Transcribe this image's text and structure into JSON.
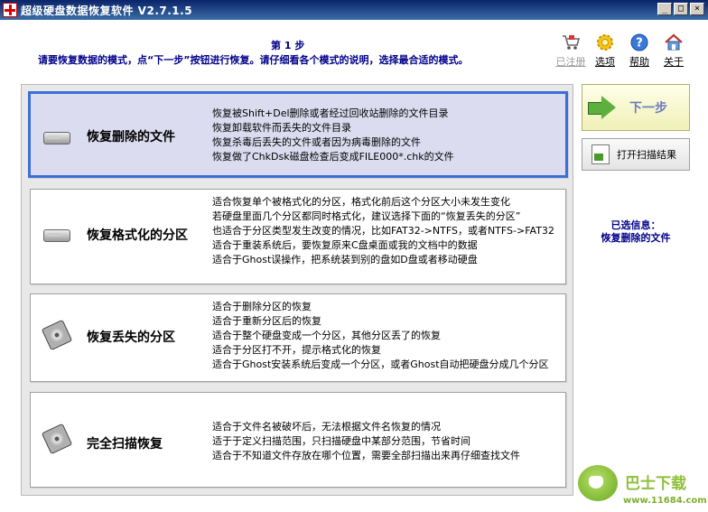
{
  "window": {
    "title": "超级硬盘数据恢复软件 V2.7.1.5",
    "controls": [
      "_",
      "□",
      "×"
    ]
  },
  "header": {
    "step": "第 1 步",
    "instruction": "请要恢复数据的模式，点“下一步”按钮进行恢复。请仔细看各个模式的说明，选择最合适的模式。"
  },
  "toolbar": {
    "items": [
      {
        "label": "已注册",
        "icon": "cart-icon",
        "disabled": true
      },
      {
        "label": "选项",
        "icon": "options-icon"
      },
      {
        "label": "帮助",
        "icon": "help-icon"
      },
      {
        "label": "关于",
        "icon": "home-icon"
      }
    ]
  },
  "modes": [
    {
      "title": "恢复删除的文件",
      "selected": true,
      "lines": [
        "恢复被Shift+Del删除或者经过回收站删除的文件目录",
        "恢复卸载软件而丢失的文件目录",
        "恢复杀毒后丢失的文件或者因为病毒删除的文件",
        "恢复做了ChkDsk磁盘检查后变成FILE000*.chk的文件"
      ]
    },
    {
      "title": "恢复格式化的分区",
      "selected": false,
      "lines": [
        "适合恢复单个被格式化的分区，格式化前后这个分区大小未发生变化",
        "若硬盘里面几个分区都同时格式化，建议选择下面的“恢复丢失的分区”",
        "也适合于分区类型发生改变的情况，比如FAT32->NTFS，或者NTFS->FAT32",
        "适合于重装系统后，要恢复原来C盘桌面或我的文档中的数据",
        "适合于Ghost误操作，把系统装到别的盘如D盘或者移动硬盘"
      ]
    },
    {
      "title": "恢复丢失的分区",
      "selected": false,
      "lines": [
        "适合于删除分区的恢复",
        "适合于重新分区后的恢复",
        "适合于整个硬盘变成一个分区，其他分区丢了的恢复",
        "适合于分区打不开，提示格式化的恢复",
        "适合于Ghost安装系统后变成一个分区，或者Ghost自动把硬盘分成几个分区"
      ]
    },
    {
      "title": "完全扫描恢复",
      "selected": false,
      "lines": [
        "适合于文件名被破坏后，无法根据文件名恢复的情况",
        "适于于定义扫描范围，只扫描硬盘中某部分范围，节省时间",
        "适合于不知道文件存放在哪个位置，需要全部扫描出来再仔细查找文件"
      ]
    }
  ],
  "actions": {
    "next_label": "下一步",
    "open_scan_label": "打开扫描结果"
  },
  "selection": {
    "heading": "已选信息：",
    "value": "恢复删除的文件"
  },
  "watermark": {
    "name": "巴士下载",
    "url": "www.11684.com"
  }
}
